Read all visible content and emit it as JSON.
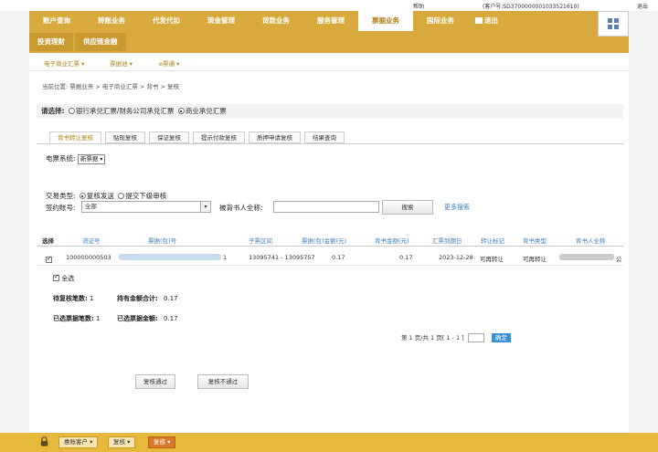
{
  "top_strip": {
    "text1": "帮助",
    "customer": "(客户号:SD3700000001033521610)",
    "user": "客户号SD3700000001033521610 移除",
    "exit": "退出"
  },
  "nav": {
    "items": [
      {
        "label": "账户查询"
      },
      {
        "label": "转账业务"
      },
      {
        "label": "代发代扣"
      },
      {
        "label": "现金管理"
      },
      {
        "label": "贷款业务"
      },
      {
        "label": "服务管理"
      },
      {
        "label": "票据业务",
        "active": true
      },
      {
        "label": "国际业务"
      }
    ],
    "user_label": "退出",
    "row2": [
      {
        "label": "投资理财"
      },
      {
        "label": "供应链金融"
      }
    ]
  },
  "subnav": {
    "items": [
      "电子商业汇票 ▾",
      "票据池 ▾",
      "e票通 ▾"
    ]
  },
  "breadcrumb": "当前位置: 票据业务 > 电子商业汇票 > 背书 > 复核",
  "radio_bar": {
    "label": "请选择:",
    "option1": "银行承兑汇票/财务公司承兑汇票",
    "option2": "商业承兑汇票"
  },
  "tabs": [
    "背书转让复核",
    "贴现复核",
    "保证复核",
    "提示付款复核",
    "质押申请复核",
    "结果查询"
  ],
  "form": {
    "system_label": "电票系统:",
    "system_value": "新票据",
    "type_label": "交易类型:",
    "type_opt1": "复核发送",
    "type_opt2": "提交下级审核",
    "account_label": "签约账号:",
    "account_value": "全部",
    "endorsee_label": "被背书人全称:",
    "endorsee_placeholder": "",
    "search_button": "搜索",
    "advanced_link": "更多搜索"
  },
  "table": {
    "headers": [
      "选择",
      "流证号",
      "票据(包)号",
      "子票区间",
      "票据(包)金额(元)",
      "背书金额(元)",
      "汇票到期日",
      "转让标记",
      "背书类型",
      "背书人全称"
    ],
    "rows": [
      {
        "checked": true,
        "serial": "100000000503",
        "bill_no_tail": "1",
        "sub_range": "13095741 - 13095757",
        "bill_amount": "0.17",
        "endorse_amount": "0.17",
        "due_date": "2023-12-28",
        "transfer_flag": "可再转让",
        "endorse_type": "可再转让",
        "endorser_tail": "公"
      }
    ],
    "select_all": "全选"
  },
  "summary": {
    "pending_count_label": "待复核笔数:",
    "pending_count": "1",
    "holding_total_label": "持有金额合计:",
    "holding_total": "0.17",
    "selected_count_label": "已选票据笔数:",
    "selected_count": "1",
    "selected_amount_label": "已选票据金额:",
    "selected_amount": "0.17"
  },
  "pager": {
    "text": "第 1 页/共 1 页[ 1 - 1 ]",
    "go": "确定"
  },
  "actions": {
    "approve": "复核通过",
    "reject": "复核不通过"
  },
  "bottom_bar": {
    "items": [
      "惠账客户 ▾",
      "复核 ▾",
      "复核 ▾"
    ]
  },
  "colors": {
    "header": "#d8a93c",
    "active_tab_text": "#b07d12",
    "link": "#3b7ec4",
    "bottom_bar": "#e6b93c"
  }
}
